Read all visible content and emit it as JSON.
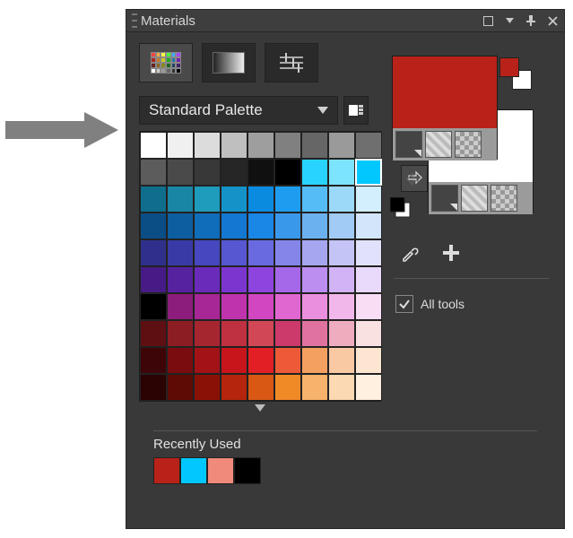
{
  "panel": {
    "title": "Materials"
  },
  "palette": {
    "name": "Standard Palette"
  },
  "options": {
    "allTools": "All tools"
  },
  "foreground": {
    "color": "#b92219"
  },
  "background": {
    "color": "#ffffff"
  },
  "selectedIndex": 17,
  "swatches": [
    "#ffffff",
    "#f0f0f0",
    "#dcdcdc",
    "#bfbfbf",
    "#9e9e9e",
    "#808080",
    "#666666",
    "#9a9a9a",
    "#6f6f6f",
    "#5c5c5c",
    "#4a4a4a",
    "#383838",
    "#262626",
    "#101010",
    "#000000",
    "#28d4ff",
    "#7de4ff",
    "#00c8ff",
    "#0e6e8c",
    "#1a86a6",
    "#1f9bbb",
    "#1593c9",
    "#0a8be0",
    "#1e9df0",
    "#55bcf5",
    "#9cd9f8",
    "#d3eefc",
    "#0b4e86",
    "#0d5ea0",
    "#0f6db9",
    "#1478d2",
    "#1a86e6",
    "#3a98ea",
    "#6cb1ef",
    "#a1cbf4",
    "#d3e5fa",
    "#30308c",
    "#3a3aa6",
    "#4747bf",
    "#5757d1",
    "#6a6ae0",
    "#8585e9",
    "#a6a6f0",
    "#c4c4f6",
    "#e1e1fb",
    "#471b86",
    "#5722a0",
    "#6a2bba",
    "#7c36d0",
    "#8e45e0",
    "#a468e8",
    "#bb8ef0",
    "#d1b3f6",
    "#e9dafb",
    "#000000",
    "#8c1d7c",
    "#a62795",
    "#bf33ad",
    "#d246c1",
    "#e066d0",
    "#ea8fdd",
    "#f2b7ea",
    "#f9ddf5",
    "#5e0f12",
    "#8c1d23",
    "#a62630",
    "#bf3140",
    "#d24756",
    "#cc3a6b",
    "#e072a0",
    "#edadbf",
    "#f9e0e1",
    "#3d0507",
    "#7a0c10",
    "#a31217",
    "#c7151b",
    "#e21f24",
    "#ec5a38",
    "#f4a060",
    "#f9c9a4",
    "#fde6d1",
    "#2b0303",
    "#5e0a05",
    "#8a1106",
    "#b5240c",
    "#d95814",
    "#f08a26",
    "#f7b26b",
    "#fbd9b2",
    "#fff0e0"
  ],
  "recent": {
    "title": "Recently Used",
    "colors": [
      "#b92219",
      "#00c8ff",
      "#f08a7a",
      "#000000"
    ]
  }
}
